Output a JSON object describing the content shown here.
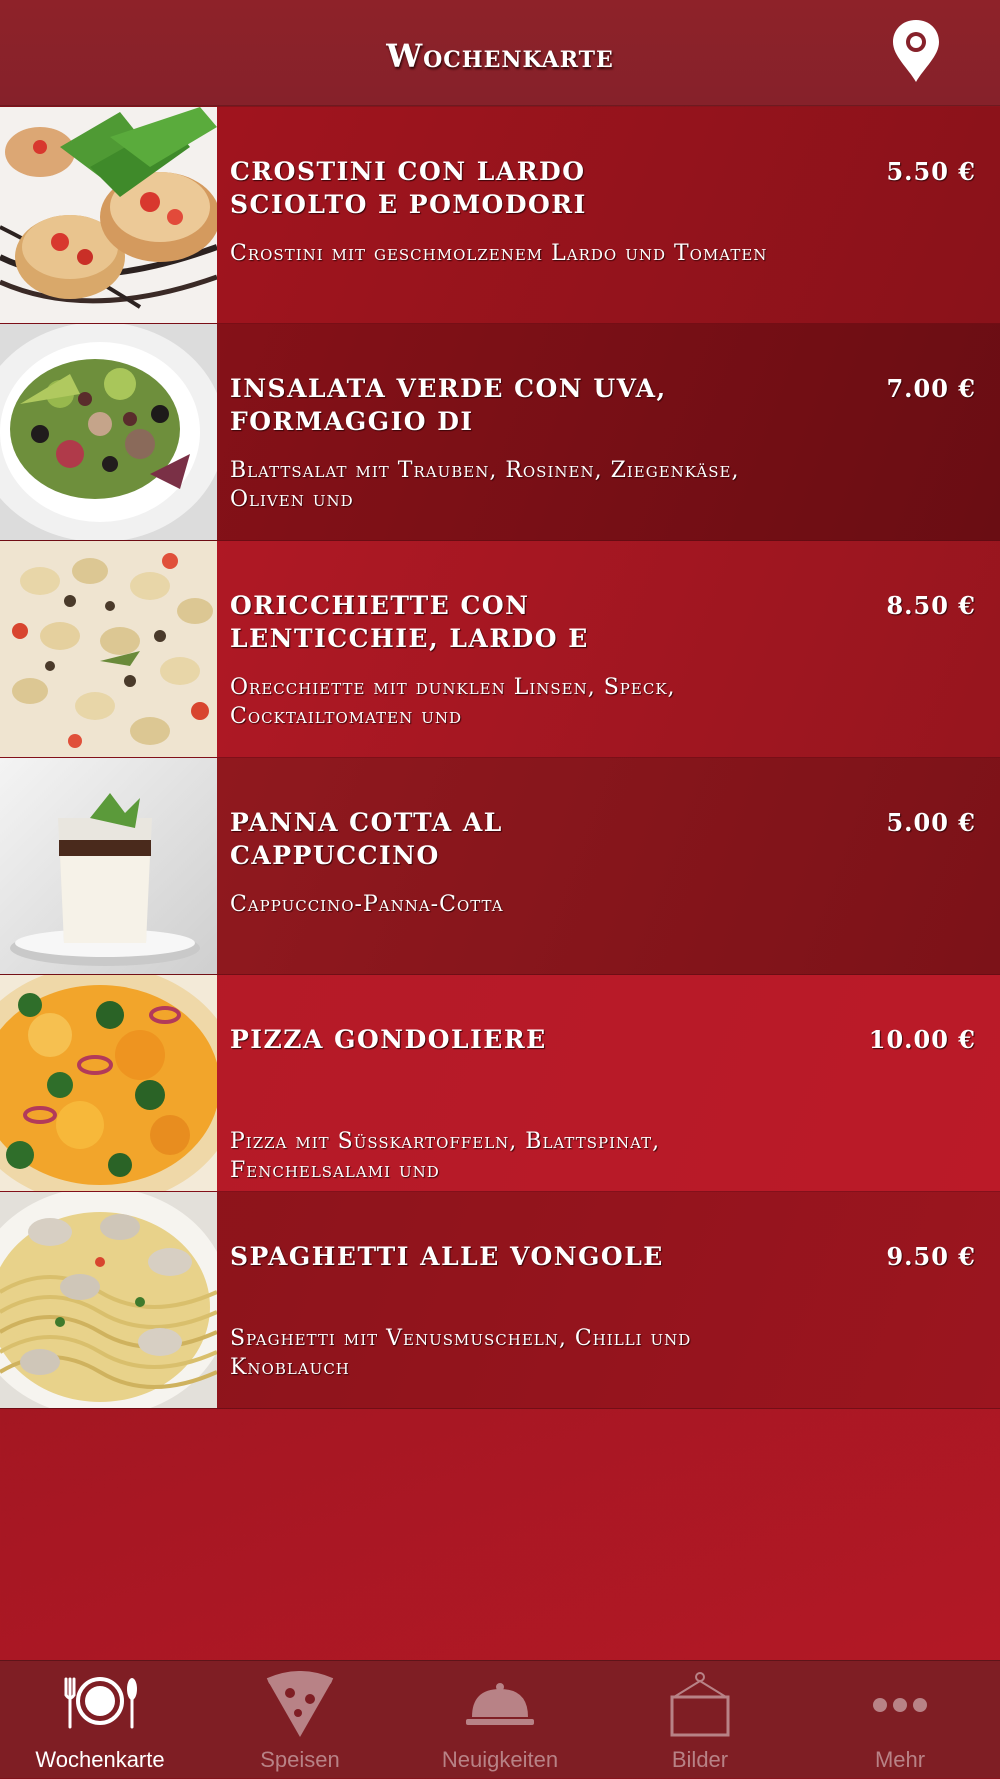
{
  "header": {
    "title": "Wochenkarte",
    "location_icon": "map-pin-icon"
  },
  "menu": {
    "items": [
      {
        "name": "CROSTINI CON LARDO SCIOLTO E POMODORI",
        "price": "5.50 €",
        "description": "Crostini mit geschmolzenem Lardo und Tomaten",
        "image": "crostini-photo"
      },
      {
        "name": "INSALATA VERDE CON UVA, FORMAGGIO DI",
        "price": "7.00 €",
        "description": "Blattsalat mit Trauben, Rosinen, Ziegenkäse, Oliven und",
        "image": "salad-photo"
      },
      {
        "name": "ORICCHIETTE CON LENTICCHIE, LARDO E",
        "price": "8.50 €",
        "description": "Orecchiette mit dunklen Linsen, Speck, Cocktailtomaten und",
        "image": "orecchiette-photo"
      },
      {
        "name": "PANNA COTTA AL CAPPUCCINO",
        "price": "5.00 €",
        "description": "Cappuccino-Panna-Cotta",
        "image": "panna-cotta-photo"
      },
      {
        "name": "PIZZA GONDOLIERE",
        "price": "10.00 €",
        "description": "Pizza mit Süsskartoffeln, Blattspinat, Fenchelsalami und",
        "image": "pizza-photo"
      },
      {
        "name": "SPAGHETTI ALLE VONGOLE",
        "price": "9.50 €",
        "description": "Spaghetti mit Venusmuscheln, Chilli und Knoblauch",
        "image": "spaghetti-photo"
      }
    ]
  },
  "tabbar": {
    "tabs": [
      {
        "label": "Wochenkarte",
        "icon": "plate-cutlery-icon",
        "active": true
      },
      {
        "label": "Speisen",
        "icon": "pizza-slice-icon",
        "active": false
      },
      {
        "label": "Neuigkeiten",
        "icon": "cloche-icon",
        "active": false
      },
      {
        "label": "Bilder",
        "icon": "picture-frame-icon",
        "active": false
      },
      {
        "label": "Mehr",
        "icon": "more-dots-icon",
        "active": false
      }
    ]
  },
  "colors": {
    "header_bg": "#86212a",
    "tabbar_bg": "#7f1e24",
    "accent_red": "#b51926",
    "active_tab_label": "#ffffff",
    "inactive_tab_label": "#b88286"
  }
}
